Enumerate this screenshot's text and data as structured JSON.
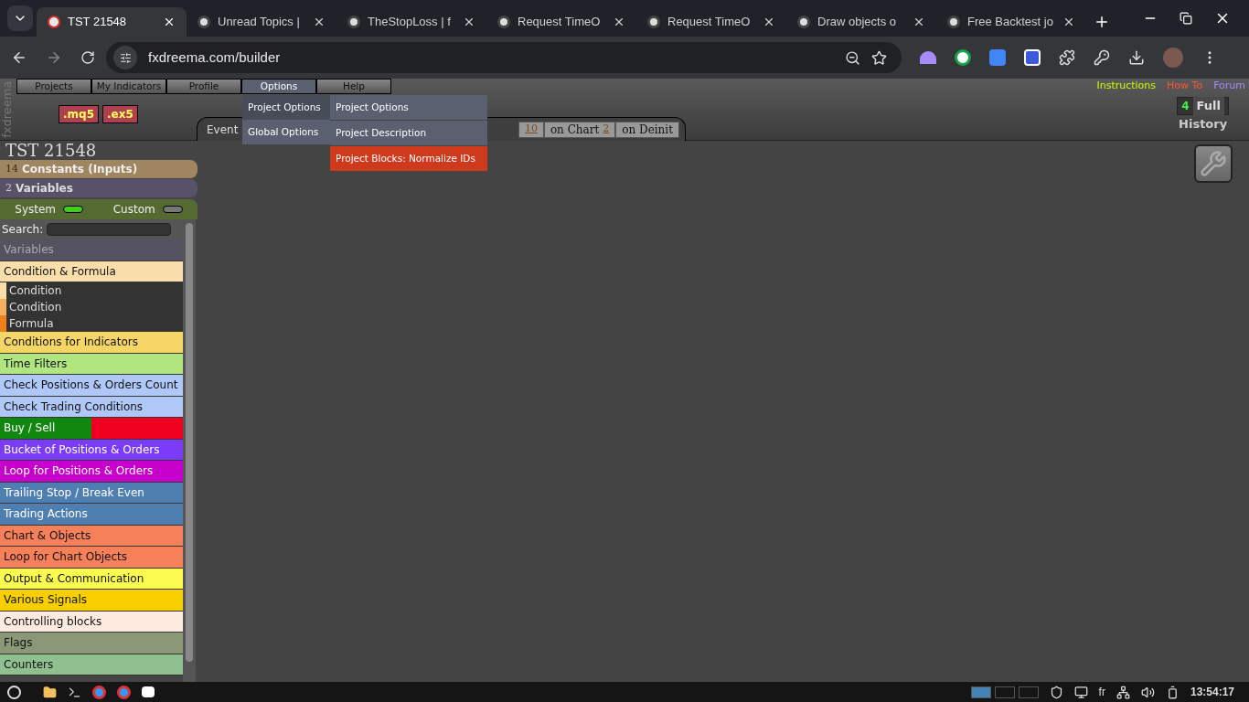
{
  "browser": {
    "tabs": [
      {
        "title": "TST 21548",
        "selected": true
      },
      {
        "title": "Unread Topics |",
        "selected": false
      },
      {
        "title": "TheStopLoss | f",
        "selected": false
      },
      {
        "title": "Request TimeO",
        "selected": false
      },
      {
        "title": "Request TimeO",
        "selected": false
      },
      {
        "title": "Draw objects o",
        "selected": false
      },
      {
        "title": "Free Backtest jo",
        "selected": false
      }
    ],
    "url": "fxdreema.com/builder"
  },
  "app": {
    "brand": "fxdreema",
    "menu": [
      {
        "label": "Projects",
        "selected": false
      },
      {
        "label": "My Indicators",
        "selected": false
      },
      {
        "label": "Profile",
        "selected": false
      },
      {
        "label": "Options",
        "selected": true
      },
      {
        "label": "Help",
        "selected": false
      }
    ],
    "dropdown": [
      {
        "label": "Project Options",
        "selected": true
      },
      {
        "label": "Global Options",
        "selected": false
      }
    ],
    "submenu": [
      {
        "label": "Project Options",
        "selected": false
      },
      {
        "label": "Project Description",
        "selected": false
      },
      {
        "label": "Project Blocks: Normalize IDs",
        "selected": true
      }
    ],
    "export_buttons": [
      ".mq5",
      ".ex5"
    ],
    "event_tabs": [
      {
        "label": "Event",
        "selected": true
      },
      {
        "count": "10",
        "selected": false
      },
      {
        "label": "on Chart",
        "count": "2",
        "selected": false
      },
      {
        "label": "on Deinit",
        "selected": false
      }
    ],
    "links": [
      {
        "label": "Instructions",
        "color": "#ccff00"
      },
      {
        "label": "How To",
        "color": "#ff5533"
      },
      {
        "label": "Forum",
        "color": "#aa88ff"
      }
    ],
    "history": {
      "count": "4",
      "button": "Full",
      "label": "History"
    },
    "project_title": "TST 21548",
    "constants": {
      "count": "14",
      "label": "Constants (Inputs)"
    },
    "variables": {
      "count": "2",
      "label": "Variables"
    },
    "toggles": [
      {
        "label": "System",
        "on": true
      },
      {
        "label": "Custom",
        "on": false
      }
    ],
    "search": {
      "label": "Search:"
    },
    "categories": [
      {
        "label": "Variables",
        "color": "#555262"
      },
      {
        "label": "Condition & Formula",
        "color": "#f9ddaa",
        "expanded": true,
        "children": [
          {
            "label": "Condition",
            "color": "#f9ddaa"
          },
          {
            "label": "Condition",
            "color": "#f4b060"
          },
          {
            "label": "Formula",
            "color": "#f08018"
          }
        ]
      },
      {
        "label": "Conditions for Indicators",
        "color": "#f5d565"
      },
      {
        "label": "Time Filters",
        "color": "#b0e580"
      },
      {
        "label": "Check Positions & Orders Count",
        "color": "#b0c8f8"
      },
      {
        "label": "Check Trading Conditions",
        "color": "#b0c8f8"
      },
      {
        "label": "Buy / Sell",
        "color": "#108810",
        "split": {
          "color": "#f00020"
        }
      },
      {
        "label": "Bucket of Positions & Orders",
        "color": "#7a3cf8"
      },
      {
        "label": "Loop for Positions & Orders",
        "color": "#c800cc"
      },
      {
        "label": "Trailing Stop / Break Even",
        "color": "#4f7fb0"
      },
      {
        "label": "Trading Actions",
        "color": "#4f7fb0"
      },
      {
        "label": "Chart & Objects",
        "color": "#f5805a"
      },
      {
        "label": "Loop for Chart Objects",
        "color": "#f5805a"
      },
      {
        "label": "Output & Communication",
        "color": "#fafa50"
      },
      {
        "label": "Various Signals",
        "color": "#f8d000"
      },
      {
        "label": "Controlling blocks",
        "color": "#fdebe0"
      },
      {
        "label": "Flags",
        "color": "#8a9878"
      },
      {
        "label": "Counters",
        "color": "#90c090"
      }
    ]
  },
  "taskbar": {
    "language": "fr",
    "clock": "13:54:17"
  }
}
